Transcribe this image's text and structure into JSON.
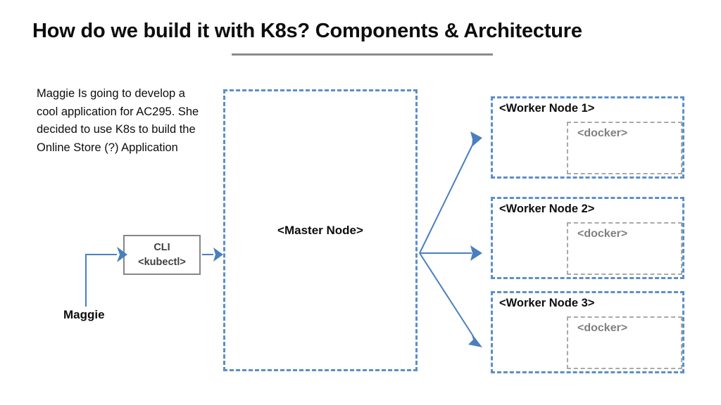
{
  "slide": {
    "title": "How do we build it with K8s? Components & Architecture",
    "description": "Maggie Is going to develop a cool application for AC295. She decided to use K8s to build the Online Store (?) Application",
    "background_color": "#ffffff",
    "divider_color": "#8c8c8c"
  },
  "actor": {
    "label": "Maggie"
  },
  "cli": {
    "line1": "CLI",
    "line2": "<kubectl>",
    "border_color": "#868686",
    "text_color": "#3f3f3f"
  },
  "master": {
    "label": "<Master Node>",
    "border_color": "#5b8fc9"
  },
  "workers": [
    {
      "label": "<Worker Node 1>",
      "container": "<docker>"
    },
    {
      "label": "<Worker Node 2>",
      "container": "<docker>"
    },
    {
      "label": "<Worker Node 3>",
      "container": "<docker>"
    }
  ],
  "colors": {
    "accent_blue": "#4a7fbf",
    "node_border_blue": "#5b8fc9",
    "docker_border_gray": "#a9a9a9",
    "docker_text_gray": "#808080",
    "text_black": "#0d0d0d"
  }
}
